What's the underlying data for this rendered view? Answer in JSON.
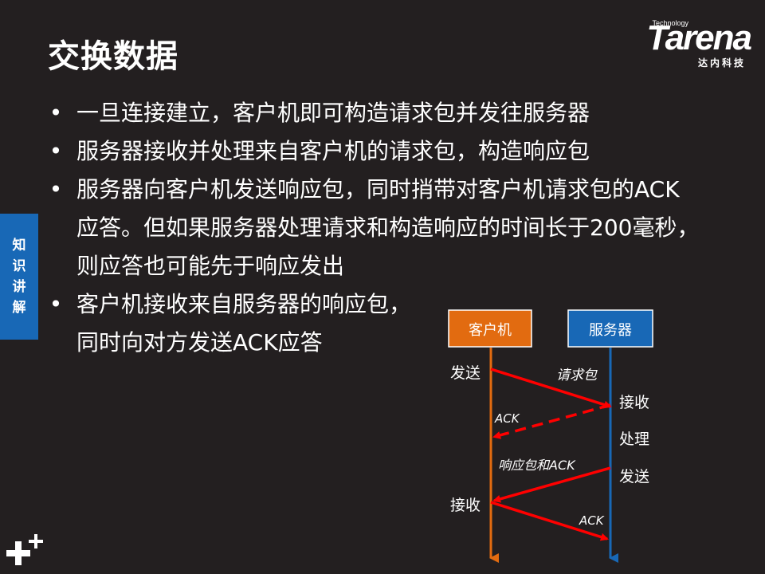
{
  "title": "交换数据",
  "logo": {
    "technology": "Technology",
    "brand": "Tarena",
    "sub": "达内科技"
  },
  "side_tab": [
    "知",
    "识",
    "讲",
    "解"
  ],
  "bullets": [
    "一旦连接建立，客户机即可构造请求包并发往服务器",
    "服务器接收并处理来自客户机的请求包，构造响应包",
    "服务器向客户机发送响应包，同时捎带对客户机请求包的ACK应答。但如果服务器处理请求和构造响应的时间长于200毫秒，则应答也可能先于响应发出",
    "客户机接收来自服务器的响应包，同时向对方发送ACK应答"
  ],
  "diagram": {
    "client_label": "客户机",
    "server_label": "服务器",
    "client_send": "发送",
    "client_recv": "接收",
    "server_recv": "接收",
    "server_process": "处理",
    "server_send": "发送",
    "msg_request": "请求包",
    "msg_ack1": "ACK",
    "msg_response": "响应包和ACK",
    "msg_ack2": "ACK",
    "colors": {
      "client": "#e26b10",
      "server": "#1868b6",
      "arrow": "#ff0000"
    }
  }
}
